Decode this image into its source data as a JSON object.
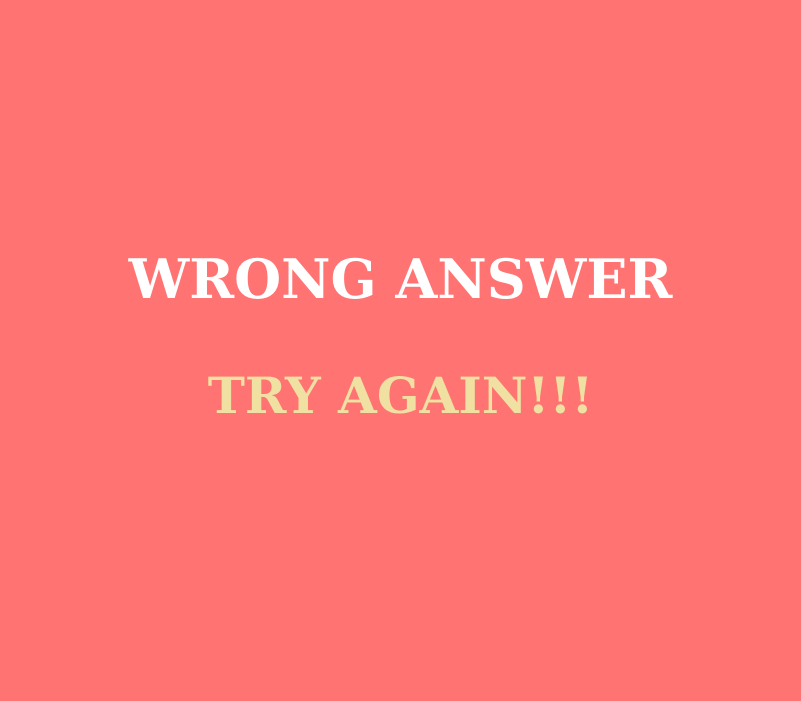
{
  "message": {
    "headline": "WRONG ANSWER",
    "subline": "TRY AGAIN!!!"
  },
  "colors": {
    "background": "#ff7373",
    "headline": "#ffffff",
    "subline": "#f0e1a2"
  }
}
